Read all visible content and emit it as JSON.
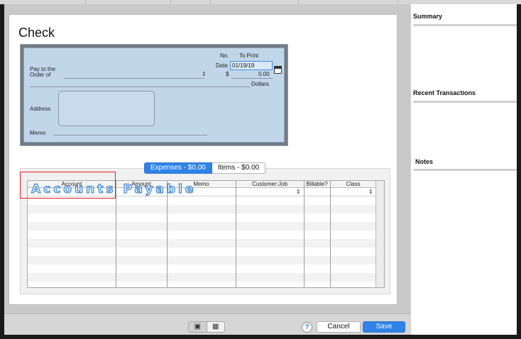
{
  "page": {
    "title": "Check"
  },
  "check": {
    "check_no_label": "No.",
    "check_no_value": "To Print",
    "date_label": "Date",
    "date_value": "01/19/19",
    "amount_label": "$",
    "amount_value": "0.00",
    "pay_to_label_line1": "Pay to the",
    "pay_to_label_line2": "Order of",
    "dollars_label": "Dollars",
    "address_label": "Address",
    "memo_label": "Memo"
  },
  "tabs": [
    {
      "label": "Expenses - $0.00",
      "selected": true
    },
    {
      "label": "Items - $0.00",
      "selected": false
    }
  ],
  "grid": {
    "columns": [
      "Account",
      "Amount",
      "Memo",
      "Customer:Job",
      "Billable?",
      "Class"
    ]
  },
  "overlay": {
    "account_text": "Accounts Payable"
  },
  "footer": {
    "help_label": "?",
    "cancel_label": "Cancel",
    "save_label": "Save"
  },
  "sidebar": {
    "summary_title": "Summary",
    "recent_title": "Recent Transactions",
    "notes_title": "Notes"
  },
  "colors": {
    "accent": "#2f83e6",
    "check_bg": "#c2d6ea",
    "highlight_box": "#e02020"
  },
  "icons": [
    "stepper-icon",
    "calendar-icon",
    "help-icon",
    "form-view-icon",
    "list-view-icon"
  ]
}
